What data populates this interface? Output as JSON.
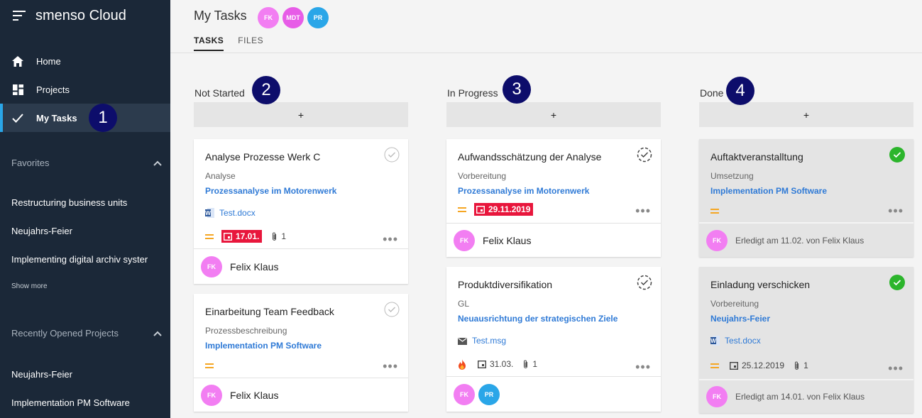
{
  "sidebar": {
    "app_title": "smenso Cloud",
    "nav": [
      {
        "label": "Home",
        "icon": "home-icon"
      },
      {
        "label": "Projects",
        "icon": "dashboard-icon"
      },
      {
        "label": "My Tasks",
        "icon": "check-icon"
      }
    ],
    "favorites": {
      "title": "Favorites",
      "items": [
        "Restructuring business units",
        "Neujahrs-Feier",
        "Implementing digital archiv syster"
      ],
      "show_more": "Show more"
    },
    "recent": {
      "title": "Recently Opened Projects",
      "items": [
        "Neujahrs-Feier",
        "Implementation PM Software"
      ]
    }
  },
  "header": {
    "title": "My Tasks",
    "avatars": [
      {
        "initials": "FK",
        "color": "#f27ef2"
      },
      {
        "initials": "MDT",
        "color": "#e75ce7"
      },
      {
        "initials": "PR",
        "color": "#2aa6e8"
      }
    ],
    "tabs": [
      "TASKS",
      "FILES"
    ]
  },
  "annotations": [
    "1",
    "2",
    "3",
    "4"
  ],
  "add_label": "+",
  "more_label": "•••",
  "colors": {
    "sidebar": "#1b2838",
    "accent": "#2aa6e8",
    "date_overdue": "#e8163c",
    "priority": "#f5a623",
    "done_check": "#2cb52c",
    "link": "#2f7ad6"
  },
  "columns": [
    {
      "title": "Not Started",
      "cards": [
        {
          "title": "Analyse Prozesse Werk C",
          "subtitle": "Analyse",
          "project": "Prozessanalyse im Motorenwerk",
          "file": "Test.docx",
          "file_type": "word-icon",
          "date": "17.01.",
          "attachments": "1",
          "assignee": "Felix Klaus",
          "assignee_initials": "FK"
        },
        {
          "title": "Einarbeitung Team Feedback",
          "subtitle": "Prozessbeschreibung",
          "project": "Implementation PM Software",
          "assignee": "Felix Klaus",
          "assignee_initials": "FK"
        }
      ]
    },
    {
      "title": "In Progress",
      "cards": [
        {
          "title": "Aufwandsschätzung der Analyse",
          "subtitle": "Vorbereitung",
          "project": "Prozessanalyse im Motorenwerk",
          "date": "29.11.2019",
          "assignee": "Felix Klaus",
          "assignee_initials": "FK"
        },
        {
          "title": "Produktdiversifikation",
          "subtitle": "GL",
          "project": "Neuausrichtung der strategischen Ziele",
          "file": "Test.msg",
          "file_type": "mail-icon",
          "date": "31.03.",
          "attachments": "1",
          "assignees": [
            "FK",
            "PR"
          ]
        }
      ]
    },
    {
      "title": "Done",
      "cards": [
        {
          "title": "Auftaktveranstalltung",
          "subtitle": "Umsetzung",
          "project": "Implementation PM Software",
          "done_note": "Erledigt am 11.02. von Felix Klaus",
          "assignee_initials": "FK"
        },
        {
          "title": "Einladung verschicken",
          "subtitle": "Vorbereitung",
          "project": "Neujahrs-Feier",
          "file": "Test.docx",
          "file_type": "word-icon",
          "date": "25.12.2019",
          "attachments": "1",
          "done_note": "Erledigt am 14.01. von Felix Klaus",
          "assignee_initials": "FK"
        }
      ]
    }
  ]
}
